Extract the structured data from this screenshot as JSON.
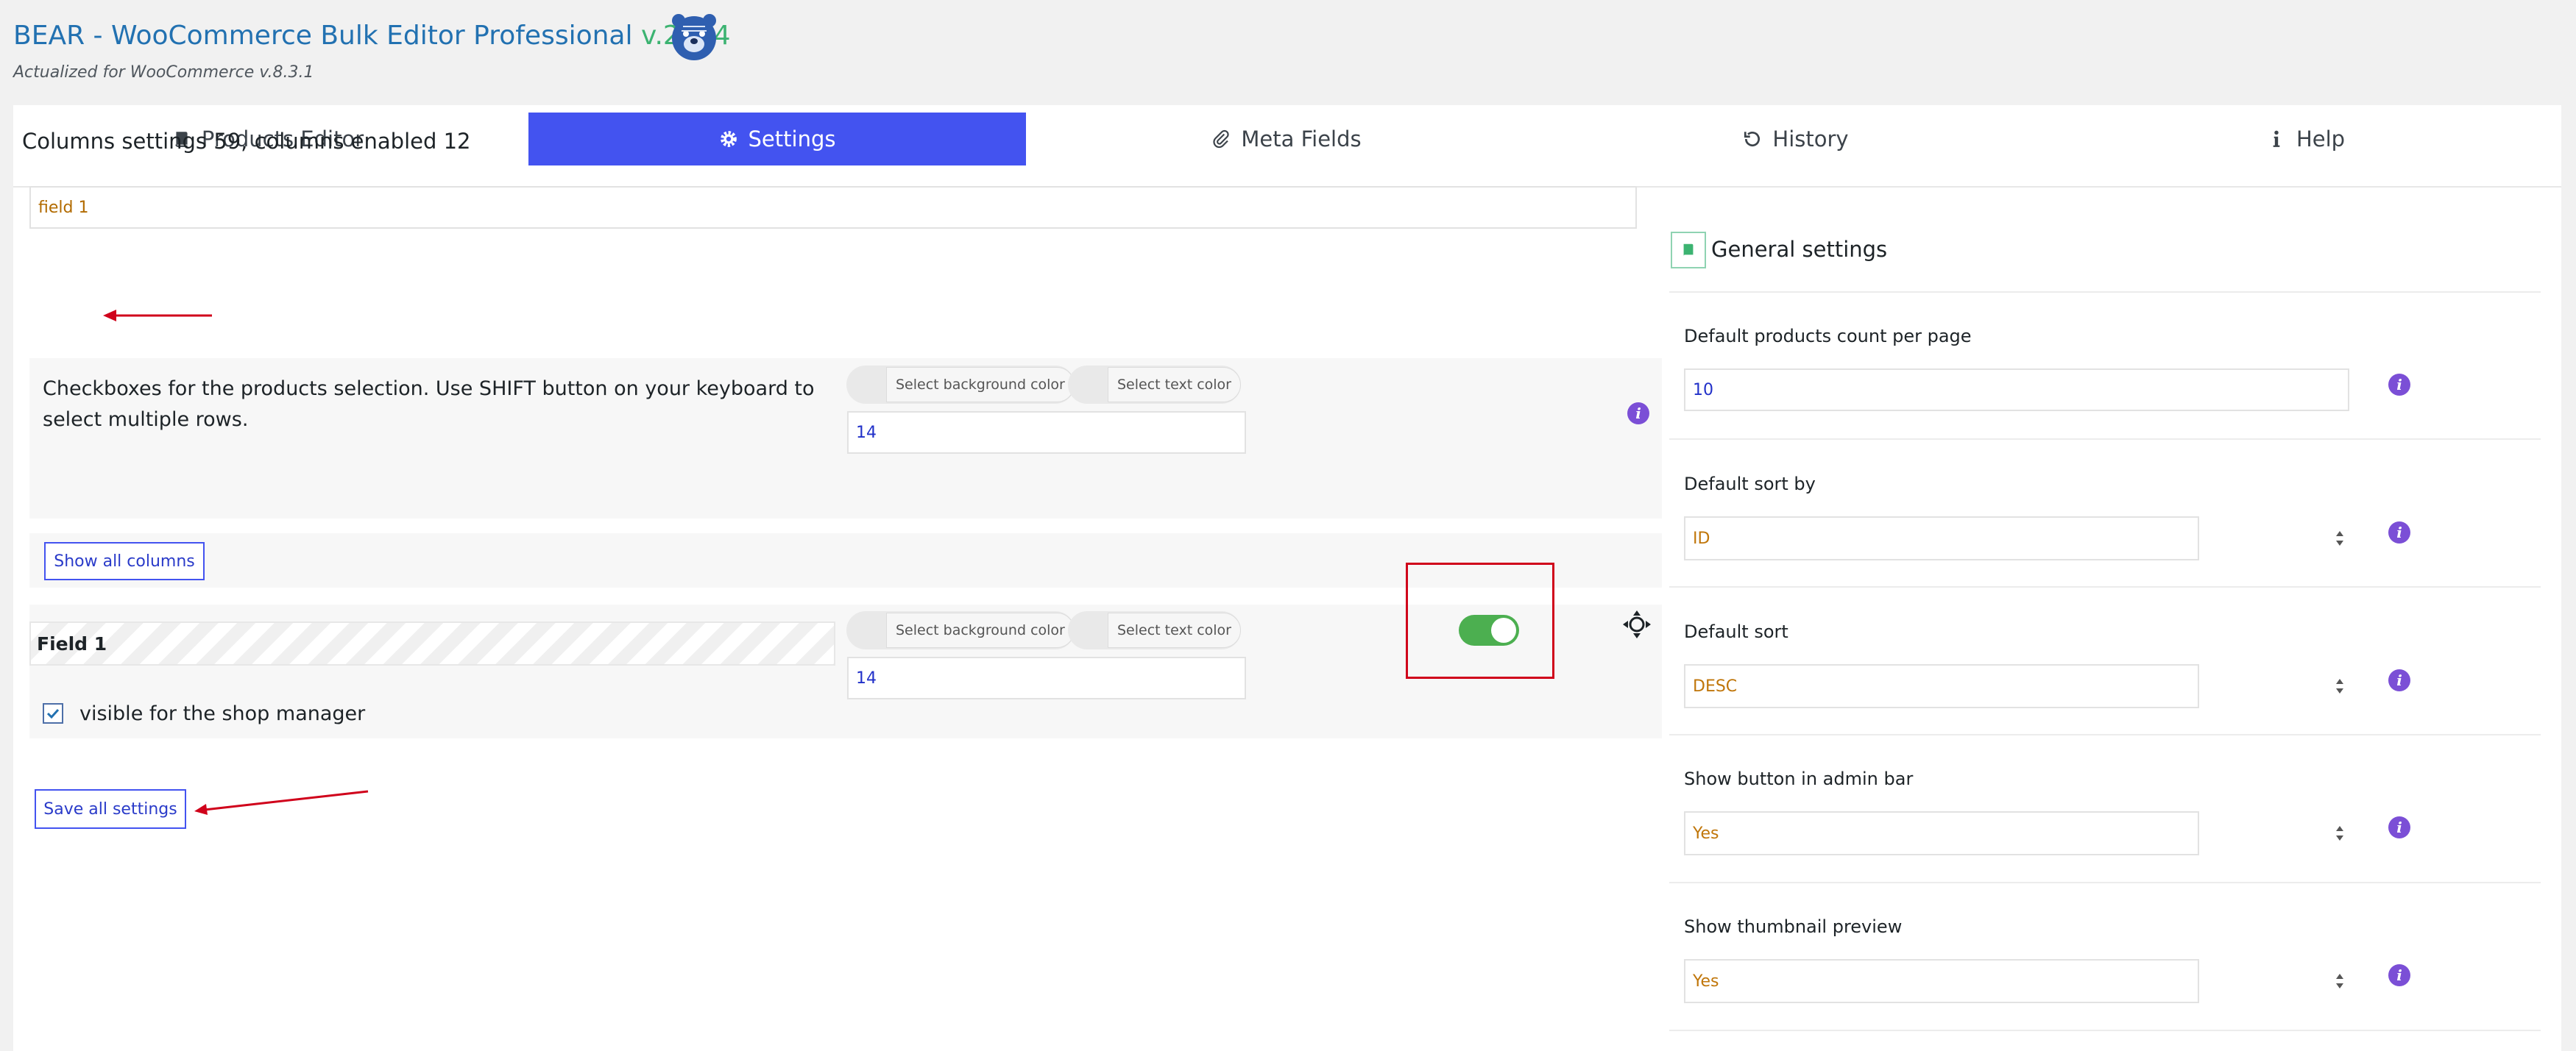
{
  "header": {
    "title": "BEAR - WooCommerce Bulk Editor Professional",
    "version": "v.2.1.4",
    "subtitle": "Actualized for WooCommerce v.8.3.1"
  },
  "tabs": [
    {
      "label": "Products Editor",
      "icon": "book-icon"
    },
    {
      "label": "Settings",
      "icon": "gear-icon",
      "active": true
    },
    {
      "label": "Meta Fields",
      "icon": "paperclip-icon"
    },
    {
      "label": "History",
      "icon": "history-icon"
    },
    {
      "label": "Help",
      "icon": "info-icon"
    }
  ],
  "columns": {
    "heading": "Columns settings 59, columns enabled 12",
    "search_value": "field 1",
    "checkbox_row": {
      "description": "Checkboxes for the products selection. Use SHIFT button on your keyboard to select multiple rows.",
      "bg_color_label": "Select background color",
      "text_color_label": "Select text color",
      "width_value": "14"
    },
    "show_all_label": "Show all columns",
    "field_row": {
      "name": "Field 1",
      "bg_color_label": "Select background color",
      "text_color_label": "Select text color",
      "width_value": "14",
      "enabled": true,
      "shop_manager_label": "visible for the shop manager",
      "shop_manager_checked": true
    },
    "save_label": "Save all settings"
  },
  "general": {
    "title": "General settings",
    "settings": [
      {
        "label": "Default products count per page",
        "value": "10",
        "kind": "input"
      },
      {
        "label": "Default sort by",
        "value": "ID",
        "kind": "select"
      },
      {
        "label": "Default sort",
        "value": "DESC",
        "kind": "select"
      },
      {
        "label": "Show button in admin bar",
        "value": "Yes",
        "kind": "select"
      },
      {
        "label": "Show thumbnail preview",
        "value": "Yes",
        "kind": "select"
      }
    ]
  },
  "colors": {
    "accent": "#4353f0",
    "toggle_on": "#4caf50",
    "info": "#7b4fd6",
    "highlight": "#d0021b",
    "select_text": "#c0760a"
  }
}
